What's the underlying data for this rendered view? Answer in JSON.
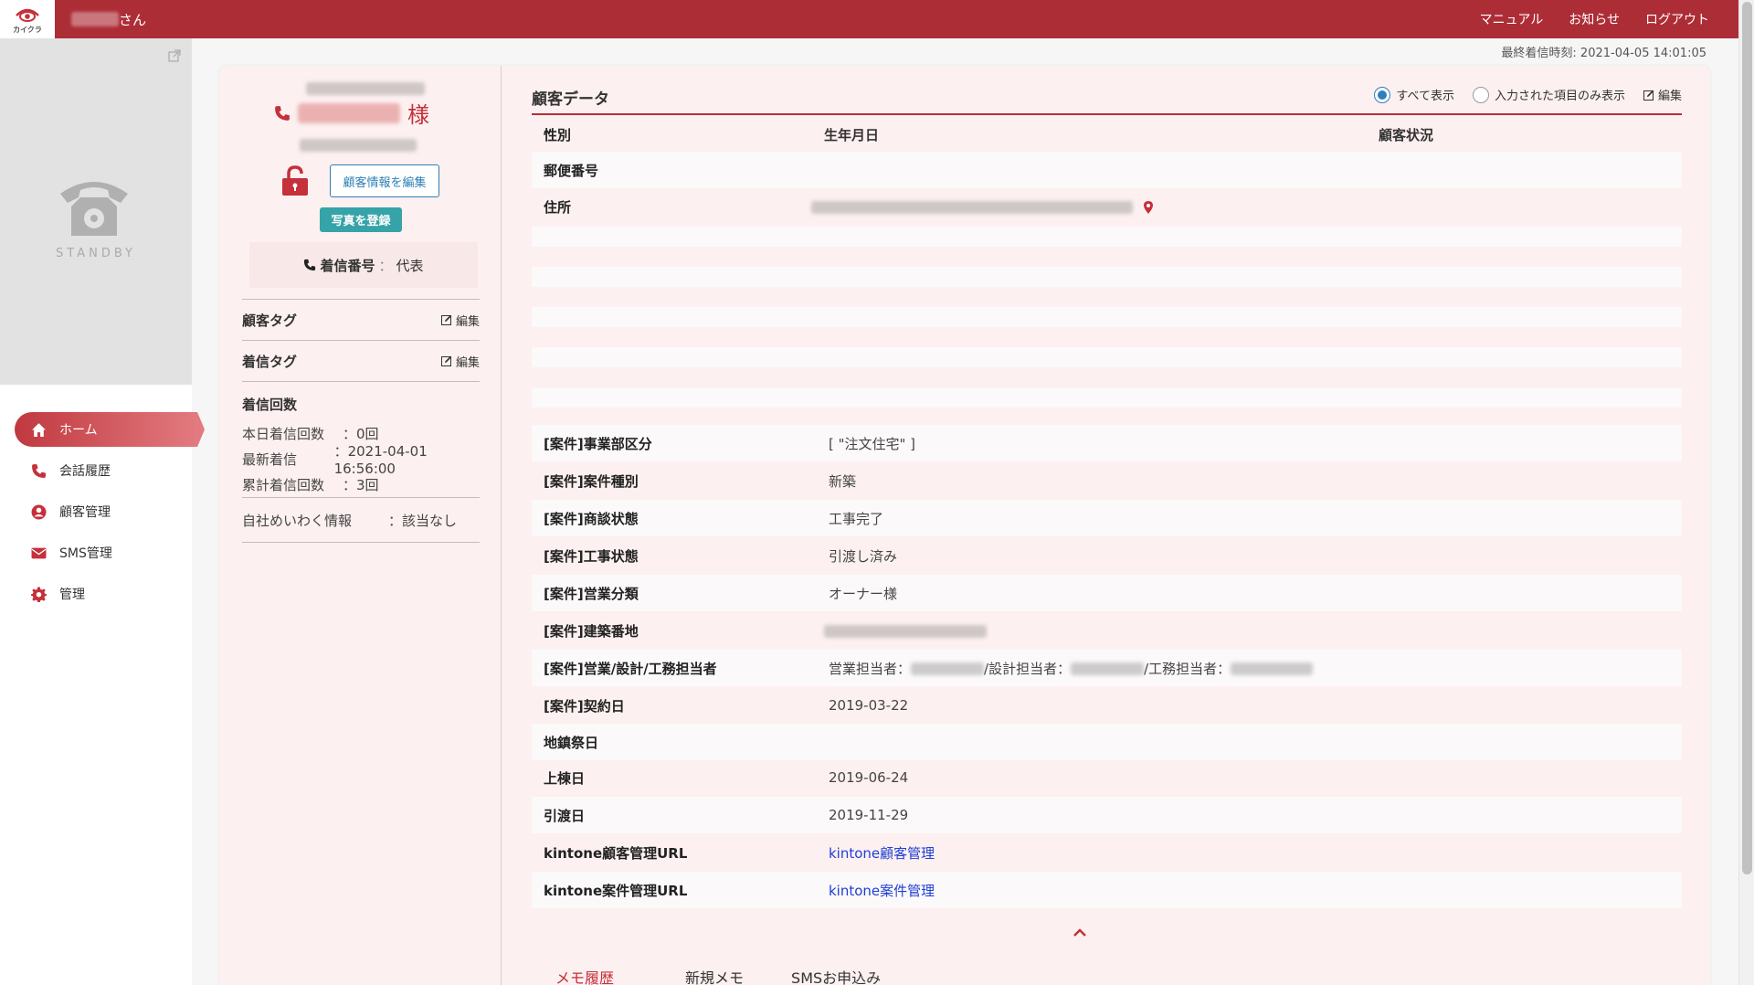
{
  "header": {
    "logo_text": "カイクラ",
    "user_suffix": "さん",
    "nav": [
      "マニュアル",
      "お知らせ",
      "ログアウト"
    ]
  },
  "last_incoming": "最終着信時刻: 2021-04-05 14:01:05",
  "standby": {
    "label": "STANDBY"
  },
  "sidebar": {
    "items": [
      {
        "label": "ホーム",
        "icon": "home-icon"
      },
      {
        "label": "会話履歴",
        "icon": "phone-icon"
      },
      {
        "label": "顧客管理",
        "icon": "user-circle-icon"
      },
      {
        "label": "SMS管理",
        "icon": "envelope-icon"
      },
      {
        "label": "管理",
        "icon": "gear-icon"
      }
    ]
  },
  "customer": {
    "honorific": "様",
    "edit_button": "顧客情報を編集",
    "photo_button": "写真を登録",
    "incoming_label": "着信番号",
    "incoming_sep": "：",
    "incoming_value": "代表",
    "tag_customer": "顧客タグ",
    "tag_incoming": "着信タグ",
    "edit_label": "編集",
    "count_title": "着信回数",
    "counts": [
      {
        "k": "本日着信回数",
        "v": "：0回"
      },
      {
        "k": "最新着信",
        "v": "：2021-04-01 16:56:00"
      },
      {
        "k": "累計着信回数",
        "v": "：3回"
      }
    ],
    "meiwaku_k": "自社めいわく情報",
    "meiwaku_v": "：該当なし"
  },
  "customer_data": {
    "title": "顧客データ",
    "opt_all": "すべて表示",
    "opt_filled": "入力された項目のみ表示",
    "edit": "編集",
    "header_row": {
      "gender": "性別",
      "birthday": "生年月日",
      "status": "顧客状況"
    },
    "postal": "郵便番号",
    "address": "住所",
    "rows": [
      {
        "k": "[案件]事業部区分",
        "v": "[ \"注文住宅\" ]"
      },
      {
        "k": "[案件]案件種別",
        "v": "新築"
      },
      {
        "k": "[案件]商談状態",
        "v": "工事完了"
      },
      {
        "k": "[案件]工事状態",
        "v": "引渡し済み"
      },
      {
        "k": "[案件]営業分類",
        "v": "オーナー様"
      },
      {
        "k": "[案件]建築番地",
        "v": ""
      },
      {
        "k": "[案件]営業/設計/工務担当者",
        "v": ""
      },
      {
        "k": "[案件]契約日",
        "v": "2019-03-22"
      },
      {
        "k": "地鎮祭日",
        "v": ""
      },
      {
        "k": "上棟日",
        "v": "2019-06-24"
      },
      {
        "k": "引渡日",
        "v": "2019-11-29"
      },
      {
        "k": "kintone顧客管理URL",
        "v": "kintone顧客管理"
      },
      {
        "k": "kintone案件管理URL",
        "v": "kintone案件管理"
      }
    ],
    "staff": {
      "sales": "営業担当者：",
      "design": "/設計担当者：",
      "works": "/工務担当者："
    }
  },
  "bottom_tabs": [
    "メモ履歴",
    "新規メモ",
    "SMSお申込み"
  ],
  "colors": {
    "brand": "#ad2d36",
    "accent_teal": "#35a3a8",
    "link": "#1f3fd6"
  }
}
